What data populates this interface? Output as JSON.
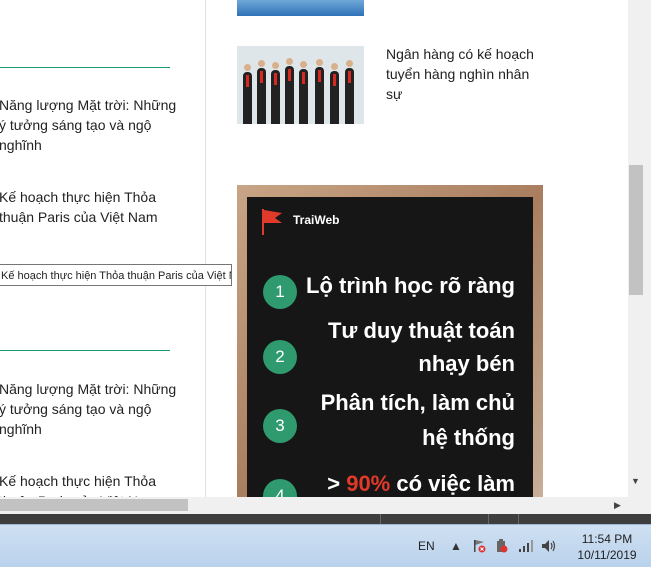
{
  "left_column": {
    "items_group1": [
      "Năng lượng Mặt trời: Những ý tưởng sáng tạo và ngộ nghĩnh",
      "Kế hoạch thực hiện Thỏa thuận Paris của Việt Nam"
    ],
    "tooltip": "Kế hoạch thực hiện Thỏa thuận Paris của Việt Nam",
    "items_group2": [
      "Năng lượng Mặt trời: Những ý tưởng sáng tạo và ngộ nghĩnh",
      "Kế hoạch thực hiện Thỏa thuận Paris của Việt Nam"
    ]
  },
  "right_column": {
    "news_title": "Ngân hàng có kế hoạch tuyển hàng nghìn nhân sự",
    "ad": {
      "brand": "TraiWeb",
      "steps": [
        {
          "num": "1",
          "lines": [
            "Lộ trình học rõ ràng"
          ]
        },
        {
          "num": "2",
          "lines": [
            "Tư duy thuật toán",
            "nhạy bén"
          ]
        },
        {
          "num": "3",
          "lines": [
            "Phân tích, làm chủ",
            "hệ thống"
          ]
        },
        {
          "num": "4",
          "prefix": "> ",
          "highlight": "90%",
          "suffix": " có việc làm"
        }
      ]
    }
  },
  "taskbar": {
    "language": "EN",
    "time": "11:54 PM",
    "date": "10/11/2019"
  },
  "colors": {
    "accent_green": "#1a9b6c",
    "ad_red": "#e23a2a",
    "step_circle": "#2e9a6e"
  }
}
